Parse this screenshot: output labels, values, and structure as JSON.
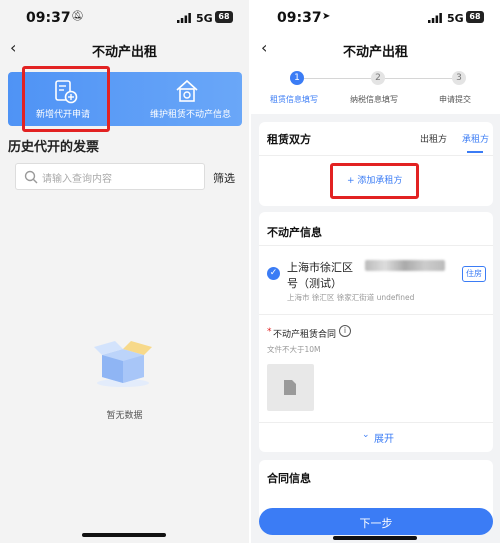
{
  "left": {
    "status": {
      "time": "09:37",
      "network": "5G",
      "battery": "68"
    },
    "nav": {
      "back": "‹",
      "title": "不动产出租"
    },
    "banner": {
      "new_invoice": "新增代开申请",
      "maintain": "维护租赁不动产信息"
    },
    "history_title": "历史代开的发票",
    "search": {
      "placeholder": "请输入查询内容",
      "filter": "筛选"
    },
    "empty": "暂无数据"
  },
  "right": {
    "status": {
      "time": "09:37",
      "network": "5G",
      "battery": "68"
    },
    "nav": {
      "back": "‹",
      "title": "不动产出租"
    },
    "steps": [
      {
        "num": "1",
        "label": "租赁信息填写"
      },
      {
        "num": "2",
        "label": "纳税信息填写"
      },
      {
        "num": "3",
        "label": "申请提交"
      }
    ],
    "parties": {
      "title": "租赁双方",
      "tab_lessor": "出租方",
      "tab_lessee": "承租方",
      "add": "+ 添加承租方"
    },
    "property": {
      "title": "不动产信息",
      "address_line1": "上海市徐汇区",
      "address_line2": "号（测试）",
      "sub_address": "上海市 徐汇区 徐家汇街道 undefined",
      "tag": "住房",
      "contract_label": "不动产租赁合同",
      "required": "*",
      "size_hint": "文件不大于10M",
      "expand": "展开"
    },
    "contract_title": "合同信息",
    "next_button": "下一步"
  },
  "colors": {
    "primary": "#3b7cf5",
    "highlight": "#e22222"
  }
}
